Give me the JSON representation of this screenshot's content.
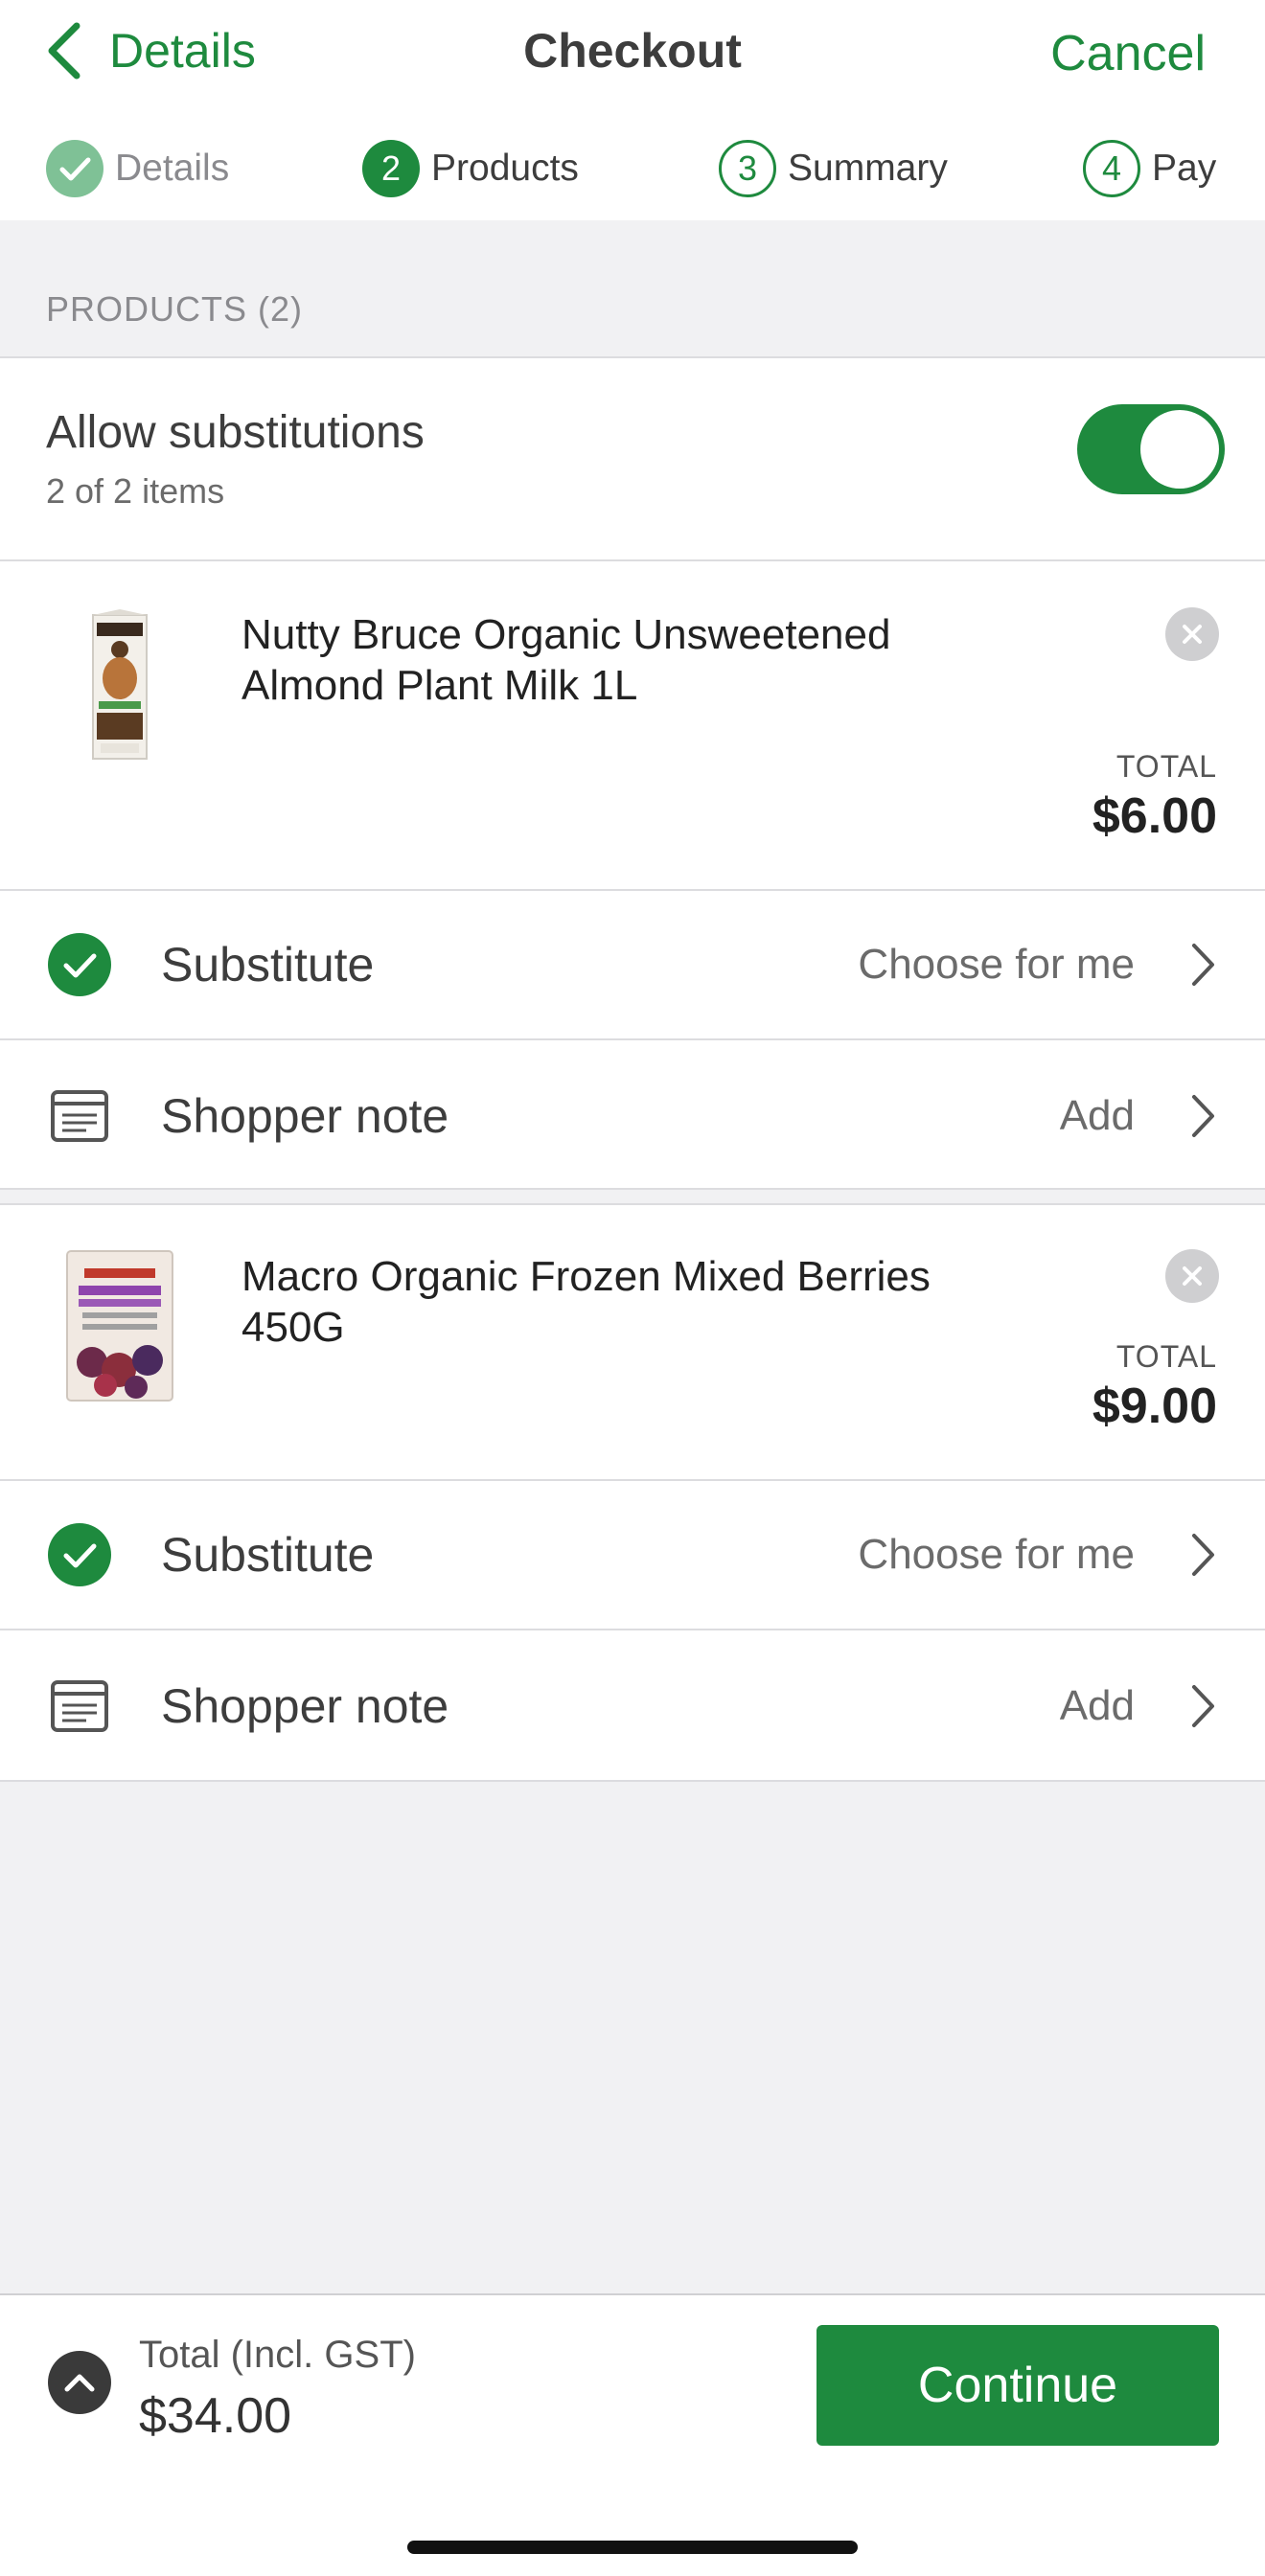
{
  "nav": {
    "back_label": "Details",
    "title": "Checkout",
    "cancel_label": "Cancel"
  },
  "steps": [
    {
      "number": "",
      "label": "Details",
      "state": "done"
    },
    {
      "number": "2",
      "label": "Products",
      "state": "active"
    },
    {
      "number": "3",
      "label": "Summary",
      "state": "todo"
    },
    {
      "number": "4",
      "label": "Pay",
      "state": "todo"
    }
  ],
  "section_label": "PRODUCTS (2)",
  "substitutions": {
    "title": "Allow substitutions",
    "subtitle": "2 of 2 items",
    "enabled": true
  },
  "products": [
    {
      "name": "Nutty Bruce Organic Unsweetened Almond Plant Milk 1L",
      "total_label": "TOTAL",
      "total": "$6.00",
      "substitute_label": "Substitute",
      "substitute_value": "Choose for me",
      "note_label": "Shopper note",
      "note_value": "Add",
      "image_icon": "almond-milk-carton"
    },
    {
      "name": "Macro Organic Frozen Mixed Berries 450G",
      "total_label": "TOTAL",
      "total": "$9.00",
      "substitute_label": "Substitute",
      "substitute_value": "Choose for me",
      "note_label": "Shopper note",
      "note_value": "Add",
      "image_icon": "mixed-berries-bag"
    }
  ],
  "footer": {
    "total_label": "Total (Incl. GST)",
    "total_value": "$34.00",
    "continue_label": "Continue"
  },
  "colors": {
    "accent": "#1e8a3e",
    "background": "#f1f1f3"
  }
}
